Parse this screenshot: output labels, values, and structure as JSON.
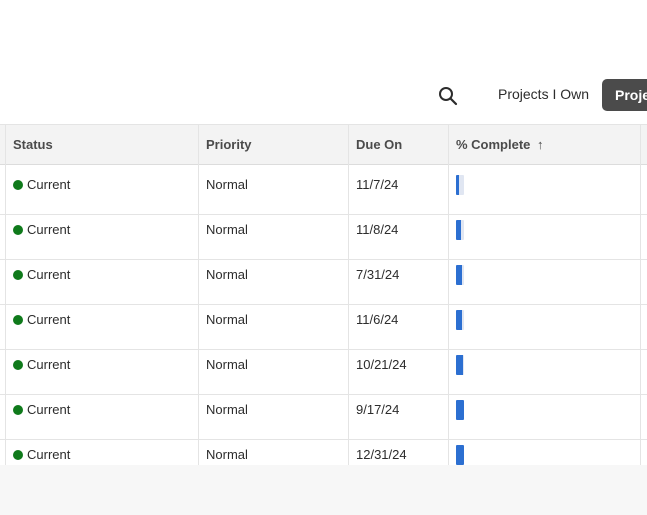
{
  "toolbar": {
    "search_icon": "search-icon",
    "projects_i_own_label": "Projects I Own",
    "projects_button_label": "Projects"
  },
  "table": {
    "headers": {
      "status": "Status",
      "priority": "Priority",
      "due_on": "Due On",
      "pct_complete": "% Complete",
      "sort_indicator": "↑"
    },
    "rows": [
      {
        "status": "Current",
        "priority": "Normal",
        "due_on": "11/7/24",
        "pct_complete": 0.03
      },
      {
        "status": "Current",
        "priority": "Normal",
        "due_on": "11/8/24",
        "pct_complete": 0.04
      },
      {
        "status": "Current",
        "priority": "Normal",
        "due_on": "7/31/24",
        "pct_complete": 0.05
      },
      {
        "status": "Current",
        "priority": "Normal",
        "due_on": "11/6/24",
        "pct_complete": 0.05
      },
      {
        "status": "Current",
        "priority": "Normal",
        "due_on": "10/21/24",
        "pct_complete": 0.06
      },
      {
        "status": "Current",
        "priority": "Normal",
        "due_on": "9/17/24",
        "pct_complete": 0.07
      },
      {
        "status": "Current",
        "priority": "Normal",
        "due_on": "12/31/24",
        "pct_complete": 0.07
      }
    ]
  },
  "colors": {
    "status_current": "#0f7a1b",
    "progress_fill": "#2c6fd1",
    "progress_track": "#e0e6f2",
    "header_bg": "#f3f3f3",
    "primary_button_bg": "#4b4b4b"
  }
}
